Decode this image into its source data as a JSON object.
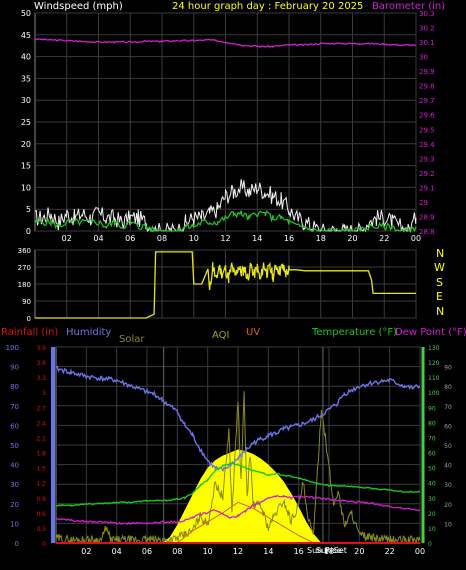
{
  "header": {
    "windspeed_label": "Windspeed (mph)",
    "title": "24 hour graph day : February 20 2025",
    "barometer_label": "Barometer (in)"
  },
  "panel2": {
    "compass_labels": [
      "N",
      "W",
      "S",
      "E",
      "N"
    ]
  },
  "panel3": {
    "rainfall_label": "Rainfall (in)",
    "humidity_label": "Humidity",
    "solar_label": "Solar",
    "aqi_label": "AQI",
    "uv_label": "UV",
    "temperature_label": "Temperature (°F)",
    "dewpoint_label": "Dew Point (°F)",
    "sunrise_label": "Sun Rise",
    "sunset_label": "Sun Set"
  },
  "colors": {
    "background": "#000000",
    "grid": "#3a3a3a",
    "frame": "#8a8a8a",
    "windspeed_gust": "#f2f2f2",
    "windspeed_avg": "#22c722",
    "barometer": "#d020d0",
    "direction": "#e6e61a",
    "rainfall": "#e01010",
    "humidity": "#6b74e6",
    "solar": "#ffff00",
    "aqi": "#8a8a1a",
    "uv": "#e06010",
    "temperature": "#18c818",
    "dewpoint": "#d020d0",
    "yellow_text": "#ffff00",
    "green_axis": "#40d040"
  },
  "chart_data": [
    {
      "type": "line",
      "panel": "wind-barometer",
      "x_ticks": [
        "02",
        "04",
        "06",
        "08",
        "10",
        "12",
        "14",
        "16",
        "18",
        "20",
        "22",
        "00"
      ],
      "y_left_ticks": [
        0,
        5,
        10,
        15,
        20,
        25,
        30,
        35,
        40,
        45,
        50
      ],
      "ylim_left": [
        0,
        50
      ],
      "y_right_ticks": [
        "28.8",
        "28.9",
        "29",
        "29.1",
        "29.2",
        "29.3",
        "29.4",
        "29.5",
        "29.6",
        "29.7",
        "29.8",
        "29.9",
        "30",
        "30.1",
        "30.2",
        "30.3"
      ],
      "ylim_right": [
        28.8,
        30.3
      ],
      "xlim": [
        0,
        24
      ],
      "series": [
        {
          "name": "Windspeed (mph)",
          "role": "gust",
          "axis": "left",
          "x": [
            0,
            0.5,
            1,
            1.5,
            2,
            2.5,
            3,
            3.5,
            4,
            4.5,
            5,
            5.5,
            6,
            6.5,
            7,
            7.5,
            8,
            8.5,
            9,
            9.5,
            10,
            10.5,
            11,
            11.5,
            12,
            12.5,
            13,
            13.5,
            14,
            14.5,
            15,
            15.5,
            16,
            16.5,
            17,
            17.5,
            18,
            18.5,
            19,
            19.5,
            20,
            20.5,
            21,
            21.5,
            22,
            22.5,
            23,
            23.5,
            24
          ],
          "values": [
            3,
            3,
            4,
            2,
            4,
            3,
            4,
            3,
            4,
            3,
            3,
            2,
            3,
            3,
            2,
            0,
            0,
            0,
            0,
            2,
            3,
            3,
            4,
            5,
            8,
            9,
            10,
            9,
            10,
            9,
            8,
            7,
            5,
            3,
            2,
            1,
            0,
            0,
            0,
            0,
            0,
            0,
            2,
            3,
            3,
            2,
            1,
            0,
            3
          ]
        },
        {
          "name": "Windspeed (mph)",
          "role": "average",
          "axis": "left",
          "x": [
            0,
            0.5,
            1,
            1.5,
            2,
            2.5,
            3,
            3.5,
            4,
            4.5,
            5,
            5.5,
            6,
            6.5,
            7,
            7.5,
            8,
            8.5,
            9,
            9.5,
            10,
            10.5,
            11,
            11.5,
            12,
            12.5,
            13,
            13.5,
            14,
            14.5,
            15,
            15.5,
            16,
            16.5,
            17,
            17.5,
            18,
            18.5,
            19,
            19.5,
            20,
            20.5,
            21,
            21.5,
            22,
            22.5,
            23,
            23.5,
            24
          ],
          "values": [
            2,
            2,
            2,
            1,
            2,
            2,
            2,
            2,
            2,
            1,
            2,
            1,
            2,
            1,
            1,
            0,
            0,
            0,
            0,
            1,
            1,
            2,
            2,
            2,
            3,
            4,
            4,
            3,
            4,
            4,
            3,
            3,
            2,
            1,
            1,
            0,
            0,
            0,
            0,
            0,
            0,
            0,
            1,
            1,
            1,
            1,
            0,
            0,
            1
          ]
        },
        {
          "name": "Barometer (in)",
          "axis": "right",
          "x": [
            0,
            1,
            2,
            3,
            4,
            5,
            6,
            7,
            8,
            9,
            10,
            11,
            12,
            13,
            14,
            15,
            16,
            17,
            18,
            19,
            20,
            21,
            22,
            23,
            24
          ],
          "values": [
            30.12,
            30.115,
            30.11,
            30.105,
            30.1,
            30.1,
            30.1,
            30.105,
            30.105,
            30.11,
            30.11,
            30.115,
            30.1,
            30.08,
            30.07,
            30.07,
            30.08,
            30.08,
            30.09,
            30.09,
            30.09,
            30.09,
            30.085,
            30.08,
            30.08
          ]
        }
      ]
    },
    {
      "type": "line",
      "panel": "wind-direction",
      "ylim": [
        0,
        360
      ],
      "y_ticks": [
        0,
        90,
        180,
        270,
        360
      ],
      "xlim": [
        0,
        24
      ],
      "series": [
        {
          "name": "direction",
          "x": [
            0,
            1,
            2,
            3,
            4,
            5,
            6,
            7,
            7.5,
            7.6,
            8,
            9,
            9.9,
            10,
            10.5,
            10.9,
            11,
            11.2,
            11.4,
            11.6,
            11.8,
            12,
            12.2,
            12.4,
            12.6,
            12.8,
            13,
            13.2,
            13.4,
            13.6,
            13.8,
            14,
            14.2,
            14.4,
            14.6,
            14.8,
            15,
            15.2,
            15.4,
            15.6,
            15.8,
            16,
            16.5,
            17,
            18,
            19,
            20,
            21,
            21.2,
            21.3,
            22,
            23,
            24
          ],
          "values": [
            0,
            0,
            0,
            0,
            0,
            0,
            0,
            0,
            20,
            350,
            350,
            350,
            350,
            180,
            180,
            260,
            140,
            280,
            200,
            270,
            230,
            260,
            210,
            275,
            220,
            270,
            240,
            260,
            215,
            275,
            230,
            265,
            200,
            285,
            240,
            265,
            220,
            275,
            250,
            270,
            235,
            255,
            255,
            250,
            250,
            250,
            250,
            250,
            200,
            130,
            130,
            130,
            130
          ]
        }
      ]
    },
    {
      "type": "line",
      "panel": "weather-solar",
      "xlim": [
        0,
        24
      ],
      "x_ticks": [
        "02",
        "04",
        "06",
        "08",
        "10",
        "12",
        "14",
        "16",
        "18",
        "20",
        "22",
        "00"
      ],
      "y_left_ticks": [
        0,
        10,
        20,
        30,
        40,
        50,
        60,
        70,
        80,
        90,
        100
      ],
      "ylim_humidity": [
        0,
        100
      ],
      "y_rain_ticks": [
        "0",
        "0.3",
        "0.6",
        "0.9",
        "1.2",
        "1.5",
        "1.8",
        "2.1",
        "2.4",
        "2.7",
        "3",
        "3.3",
        "3.6",
        "3.9"
      ],
      "ylim_rain": [
        0,
        3.9
      ],
      "y_temp_ticks": [
        0,
        10,
        20,
        30,
        40,
        50,
        60,
        70,
        80,
        90,
        100,
        110,
        120,
        130
      ],
      "ylim_temp": [
        0,
        130
      ],
      "y_uv_ticks": [
        10,
        20,
        30,
        40,
        50,
        60,
        70,
        80,
        90
      ],
      "series": [
        {
          "name": "Humidity",
          "axis": "humidity",
          "x": [
            0,
            0.5,
            1,
            2,
            3,
            4,
            5,
            6,
            6.5,
            7,
            7.5,
            8,
            8.5,
            9,
            9.5,
            10,
            10.5,
            11,
            11.5,
            12,
            12.5,
            13,
            13.5,
            14,
            14.5,
            15,
            15.5,
            16,
            17,
            18,
            18.5,
            19,
            20,
            21,
            22,
            23,
            23.5,
            24
          ],
          "values": [
            89,
            88,
            87,
            85,
            84,
            83,
            80,
            77,
            76,
            73,
            70,
            67,
            60,
            55,
            48,
            42,
            38,
            37,
            40,
            43,
            47,
            51,
            53,
            55,
            56,
            58,
            59,
            60,
            63,
            68,
            71,
            76,
            80,
            82,
            83,
            80,
            79,
            80
          ]
        },
        {
          "name": "Temperature (°F)",
          "axis": "temp",
          "x": [
            0,
            1,
            2,
            3,
            4,
            5,
            6,
            7,
            8,
            8.5,
            9,
            9.5,
            10,
            10.5,
            11,
            11.5,
            12,
            12.5,
            13,
            13.5,
            14,
            14.5,
            15,
            15.5,
            16,
            17,
            18,
            19,
            20,
            21,
            22,
            23,
            24
          ],
          "values": [
            25,
            25,
            26,
            26,
            27,
            27,
            28,
            28,
            29,
            30,
            33,
            38,
            42,
            48,
            51,
            53,
            52,
            50,
            48,
            47,
            45,
            46,
            45,
            44,
            43,
            40,
            38,
            38,
            37,
            36,
            35,
            34,
            34
          ]
        },
        {
          "name": "Dew Point (°F)",
          "axis": "temp",
          "x": [
            0,
            1,
            2,
            3,
            4,
            5,
            6,
            7,
            8,
            8.5,
            9,
            9.5,
            10,
            10.5,
            11,
            11.5,
            12,
            12.5,
            13,
            13.5,
            14,
            14.5,
            15,
            15.5,
            16,
            17,
            18,
            19,
            20,
            21,
            22,
            23,
            24
          ],
          "values": [
            16,
            15,
            14,
            14,
            13,
            13,
            13,
            14,
            14,
            15,
            17,
            19,
            20,
            22,
            19,
            17,
            18,
            21,
            25,
            27,
            30,
            31,
            31,
            30,
            31,
            30,
            29,
            28,
            27,
            26,
            24,
            23,
            22
          ]
        },
        {
          "name": "UV",
          "axis": "temp",
          "x": [
            8,
            9,
            10,
            11,
            12,
            13,
            14,
            15,
            16,
            17
          ],
          "values": [
            0,
            8,
            14,
            20,
            27,
            23,
            17,
            11,
            5,
            0
          ]
        },
        {
          "name": "Solar",
          "axis": "temp",
          "x": [
            7,
            7.5,
            8,
            8.5,
            9,
            9.5,
            10,
            10.5,
            11,
            11.5,
            12,
            12.5,
            13,
            13.5,
            14,
            14.5,
            15,
            15.5,
            16,
            16.5,
            17,
            17.5
          ],
          "values": [
            0,
            4,
            12,
            22,
            32,
            42,
            50,
            55,
            58,
            60,
            62,
            61,
            59,
            56,
            52,
            47,
            41,
            33,
            24,
            14,
            6,
            0
          ]
        },
        {
          "name": "AQI",
          "axis": "temp",
          "x": [
            0,
            1,
            2,
            3,
            3.3,
            3.6,
            4,
            5,
            6,
            7,
            7.5,
            8,
            9,
            9.5,
            10,
            10.5,
            11,
            11.4,
            11.6,
            12,
            12.2,
            12.4,
            12.6,
            12.8,
            13,
            13.5,
            14,
            14.5,
            15,
            15.5,
            16,
            16.3,
            16.6,
            17,
            17.5,
            18,
            18.3,
            18.6,
            19,
            19.5,
            20,
            21,
            22,
            23,
            24
          ],
          "values": [
            3,
            2,
            2,
            2,
            10,
            2,
            2,
            2,
            2,
            2,
            2,
            3,
            8,
            18,
            12,
            40,
            30,
            75,
            20,
            95,
            40,
            98,
            30,
            60,
            25,
            25,
            10,
            20,
            28,
            15,
            25,
            40,
            15,
            8,
            90,
            50,
            25,
            35,
            12,
            20,
            5,
            3,
            2,
            2,
            2
          ]
        },
        {
          "name": "Rainfall (in)",
          "axis": "rain",
          "x": [
            0,
            24
          ],
          "values": [
            0,
            0
          ]
        }
      ],
      "sunrise_hour": 7.1,
      "sunset_hour": 17.6
    }
  ]
}
